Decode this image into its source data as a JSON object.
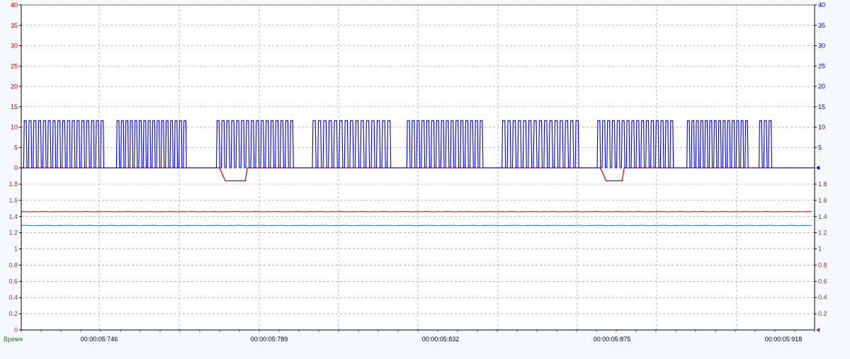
{
  "chart_data": {
    "type": "line",
    "xlabel": "Время",
    "x_ticks": [
      "00:00:05:746",
      "00:00:05:789",
      "00:00:05:832",
      "00:00:05:875",
      "00:00:05:918"
    ],
    "grid": true,
    "upper_panel": {
      "ylim": [
        0,
        40
      ],
      "y_ticks_left": [
        "0",
        "5",
        "10",
        "15",
        "20",
        "25",
        "30",
        "35",
        "40"
      ],
      "y_ticks_right": [
        "0",
        "5",
        "10",
        "15",
        "20",
        "25",
        "30",
        "35",
        "40"
      ],
      "series": [
        {
          "color": "#0000ee",
          "description": "pulse train",
          "high": 11.6,
          "low": 0,
          "bursts_x": [
            [
              0.3,
              10.6
            ],
            [
              12.0,
              21.0
            ],
            [
              24.6,
              34.5
            ],
            [
              36.7,
              46.8
            ],
            [
              48.6,
              58.4
            ],
            [
              60.6,
              70.5
            ],
            [
              72.6,
              82.4
            ],
            [
              83.9,
              91.8
            ],
            [
              93.0,
              94.8
            ]
          ],
          "pulses_per_burst": [
            17,
            16,
            16,
            15,
            16,
            15,
            16,
            14,
            3
          ]
        },
        {
          "color": "#cc0000",
          "description": "level with two dips",
          "baseline": 0,
          "dips": [
            {
              "x_start": 25.0,
              "x_end": 28.5,
              "value": -3.2
            },
            {
              "x_start": 73.0,
              "x_end": 76.0,
              "value": -3.2
            }
          ]
        }
      ]
    },
    "lower_panel": {
      "ylim": [
        0,
        2
      ],
      "y_ticks_left": [
        "0",
        "0.2",
        "0.4",
        "0.6",
        "0.8",
        "1",
        "1.2",
        "1.4",
        "1.6",
        "1.8"
      ],
      "y_ticks_right": [
        "0",
        "0.2",
        "0.4",
        "0.6",
        "0.8",
        "1",
        "1.2",
        "1.4",
        "1.6",
        "1.8"
      ],
      "series": [
        {
          "color": "#993333",
          "value": 1.46
        },
        {
          "color": "#3a9a9a",
          "value": 1.29
        }
      ]
    },
    "x_range": [
      0,
      100
    ],
    "colors": {
      "left_axis_upper": "#cc0000",
      "right_axis_upper": "#0000ee",
      "left_axis_lower": "#993333",
      "right_axis_lower": "#993333",
      "xlabel": "#227722",
      "grid": "#888888"
    }
  }
}
